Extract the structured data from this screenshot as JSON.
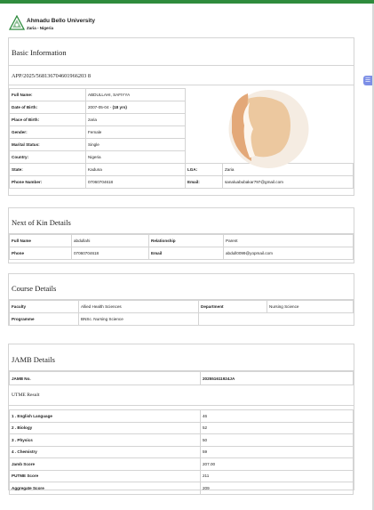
{
  "university": {
    "name": "Ahmadu Bello University",
    "location": "Zaria - Nigeria"
  },
  "basic": {
    "title": "Basic Information",
    "app_no": "APP/2025/568136704601966203 8",
    "rows": [
      {
        "label": "Full Name:",
        "value": "ABDULLAHI, SAFIYYA"
      },
      {
        "label": "Date of Birth:",
        "value": "2007-05-04 - ",
        "extra": "(18 yrs)"
      },
      {
        "label": "Place of Birth:",
        "value": "zaria"
      },
      {
        "label": "Gender:",
        "value": "Female"
      },
      {
        "label": "Marital Status:",
        "value": "Single"
      },
      {
        "label": "Country:",
        "value": "Nigeria"
      }
    ],
    "state_label": "State:",
    "state_value": "Kaduna",
    "lga_label": "LGA:",
    "lga_value": "Zaria",
    "phone_label": "Phone Number:",
    "phone_value": "07060704618",
    "email_label": "Email:",
    "email_value": "sanaluabubakar797@gmail.com"
  },
  "kin": {
    "title": "Next of Kin Details",
    "fullname_label": "Full Name",
    "fullname_value": "abdullahi",
    "relationship_label": "Relationship",
    "relationship_value": "Parent",
    "phone_label": "Phone",
    "phone_value": "07060704618",
    "email_label": "Email",
    "email_value": "abdull0099@yopmail.com"
  },
  "course": {
    "title": "Course Details",
    "faculty_label": "Faculty",
    "faculty_value": "Allied Health Sciences",
    "department_label": "Department",
    "department_value": "Nursing Science",
    "programme_label": "Programme",
    "programme_value": "BNSc. Nursing Science"
  },
  "jamb": {
    "title": "JAMB Details",
    "no_label": "JAMB No.",
    "no_value": "202551611924JA",
    "utme_title": "UTME Result",
    "subjects": [
      {
        "label": "1 . English Language",
        "score": "46"
      },
      {
        "label": "2 . Biology",
        "score": "52"
      },
      {
        "label": "3 . Physics",
        "score": "50"
      },
      {
        "label": "4 . Chemistry",
        "score": "59"
      }
    ],
    "totals": [
      {
        "label": "Jamb Score",
        "score": "207.00"
      },
      {
        "label": "PUTME Score",
        "score": "211"
      },
      {
        "label": "Aggregate Score",
        "score": "209"
      }
    ]
  },
  "colors": {
    "accent": "#2e8b3d",
    "border": "#d4d4d4",
    "photo_bg": "#f5ece2",
    "skin": "#e8b98a"
  }
}
